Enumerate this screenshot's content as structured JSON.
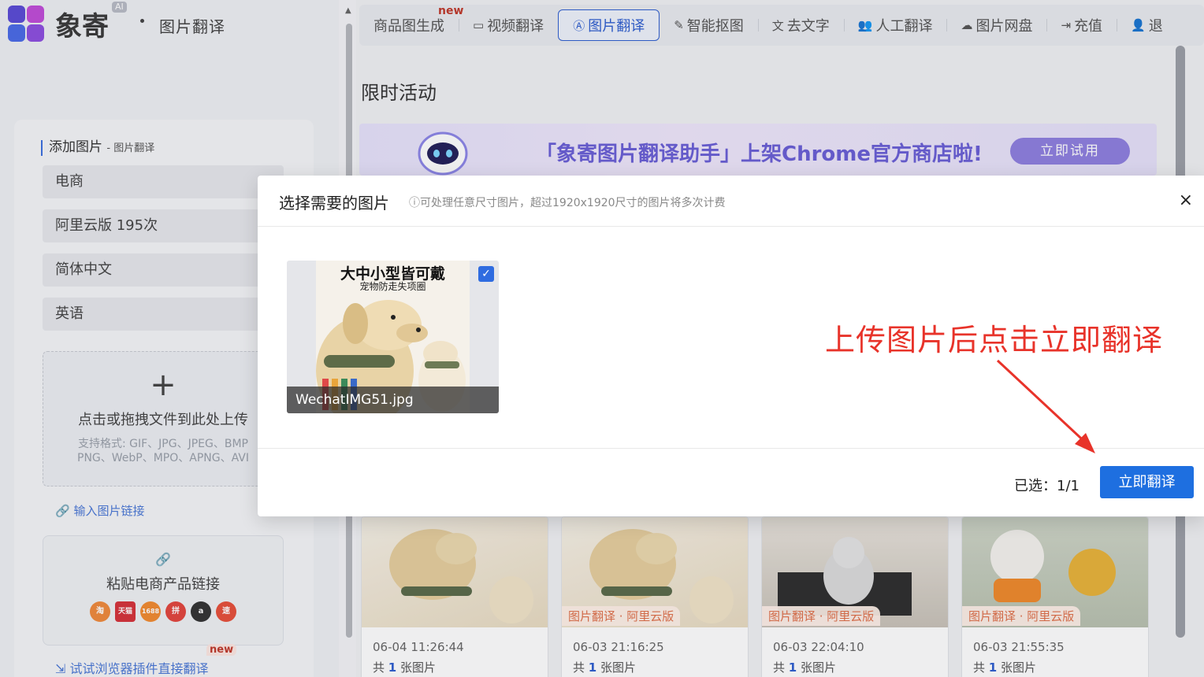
{
  "brand": {
    "name": "象寄",
    "badge": "AI",
    "section": "图片翻译"
  },
  "sidebar": {
    "title": "添加图片",
    "title_sub": "- 图片翻译",
    "selects": [
      "电商",
      "阿里云版   195次",
      "简体中文",
      "英语"
    ],
    "upload_hint": "点击或拖拽文件到此处上传",
    "formats_line1": "支持格式: GIF、JPG、JPEG、BMP",
    "formats_line2": "PNG、WebP、MPO、APNG、AVI",
    "link_input": "输入图片链接",
    "paste_label": "粘贴电商产品链接",
    "shops": [
      {
        "name": "淘",
        "color": "#f08a3c"
      },
      {
        "name": "天猫",
        "color": "#d6323a"
      },
      {
        "name": "1688",
        "color": "#f28b30"
      },
      {
        "name": "拼",
        "color": "#e3463d"
      },
      {
        "name": "a",
        "color": "#333333"
      },
      {
        "name": "速",
        "color": "#e8503a"
      }
    ],
    "plugin_link": "试试浏览器插件直接翻译",
    "new_tag": "new"
  },
  "nav": {
    "new_tag": "new",
    "items": [
      {
        "label": "商品图生成",
        "icon": ""
      },
      {
        "label": "视频翻译",
        "icon": "▭"
      },
      {
        "label": "图片翻译",
        "icon": "Ⓐ"
      },
      {
        "label": "智能抠图",
        "icon": "✎"
      },
      {
        "label": "去文字",
        "icon": "文"
      },
      {
        "label": "人工翻译",
        "icon": "👥"
      },
      {
        "label": "图片网盘",
        "icon": "☁"
      },
      {
        "label": "充值",
        "icon": "⇥"
      },
      {
        "label": "退",
        "icon": "👤"
      }
    ]
  },
  "main": {
    "section_title": "限时活动",
    "banner_text": "「象寄图片翻译助手」上架Chrome官方商店啦!",
    "banner_button": "立即试用",
    "cards": [
      {
        "date": "06-04 11:26:44",
        "count_prefix": "共",
        "count": "1",
        "count_suffix": "张图片",
        "tag": ""
      },
      {
        "date": "06-03 21:16:25",
        "count_prefix": "共",
        "count": "1",
        "count_suffix": "张图片",
        "tag": "图片翻译 · 阿里云版"
      },
      {
        "date": "06-03 22:04:10",
        "count_prefix": "共",
        "count": "1",
        "count_suffix": "张图片",
        "tag": "图片翻译 · 阿里云版"
      },
      {
        "date": "06-03 21:55:35",
        "count_prefix": "共",
        "count": "1",
        "count_suffix": "张图片",
        "tag": "图片翻译 · 阿里云版"
      }
    ]
  },
  "modal": {
    "title": "选择需要的图片",
    "note": "ⓘ可处理任意尺寸图片，超过1920x1920尺寸的图片将多次计费",
    "close": "×",
    "image": {
      "headline": "大中小型皆可戴",
      "subline": "宠物防走失项圈",
      "filename": "WechatIMG51.jpg",
      "checked": true
    },
    "annotation": "上传图片后点击立即翻译",
    "selected_label": "已选：1/1",
    "confirm_button": "立即翻译"
  },
  "colors": {
    "accent": "#1e6fe0",
    "annotation": "#e8332a"
  }
}
